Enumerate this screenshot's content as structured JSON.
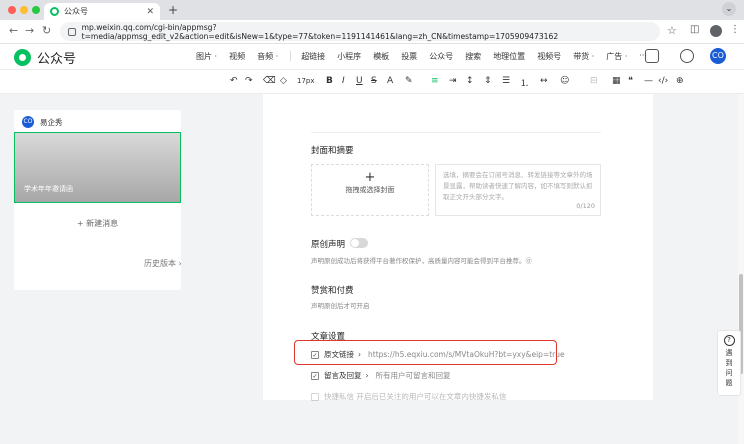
{
  "browser": {
    "tab_title": "公众号",
    "url": "mp.weixin.qq.com/cgi-bin/appmsg?t=media/appmsg_edit_v2&action=edit&isNew=1&type=77&token=1191141461&lang=zh_CN&timestamp=1705909473162"
  },
  "header": {
    "logo_text": "公众号",
    "menu": [
      "图片 ·",
      "视频",
      "音频 ·",
      "超链接",
      "小程序",
      "模板",
      "投票",
      "公众号",
      "搜索",
      "地理位置",
      "视频号",
      "带货 ·",
      "广告 ·",
      "···"
    ]
  },
  "format_bar": {
    "font_size": "17px",
    "bold": "B",
    "italic": "I",
    "underline": "U",
    "strike": "S",
    "font_color": "A"
  },
  "sidebar": {
    "account_name": "易企秀",
    "account_avatar": "CO",
    "article_title": "学术年年邀请函",
    "new_message": "+ 新建消息",
    "history": "历史版本 ›"
  },
  "editor": {
    "cover_section": "封面和摘要",
    "cover_placeholder": "拖拽或选择封面",
    "summary_placeholder": "选填，摘要会在订阅号消息、转发链接等文章外的场景显露，帮助读者快速了解内容，如不填写则默认抓取正文开头部分文字。",
    "summary_count": "0/120",
    "original_title": "原创声明",
    "original_desc": "声明原创成功后将获得平台著作权保护，高质量内容可能会得到平台推荐。⓪",
    "reward_title": "赞赏和付费",
    "reward_desc": "声明原创后才可开启",
    "settings_title": "文章设置",
    "source_link_label": "原文链接",
    "source_link_value": "https://h5.eqxiu.com/s/MVtaOkuH?bt=yxy&eip=true",
    "comment_label": "留言及回复",
    "comment_value": "所有用户可留言和回复",
    "hidden_row": "快捷私信  开启后已关注的用户可以在文章内快捷发私信"
  },
  "help": {
    "label": "遇到问题"
  },
  "colors": {
    "accent": "#07c160",
    "highlight_box": "#e0352b",
    "brand_blue": "#1a5cd6"
  }
}
